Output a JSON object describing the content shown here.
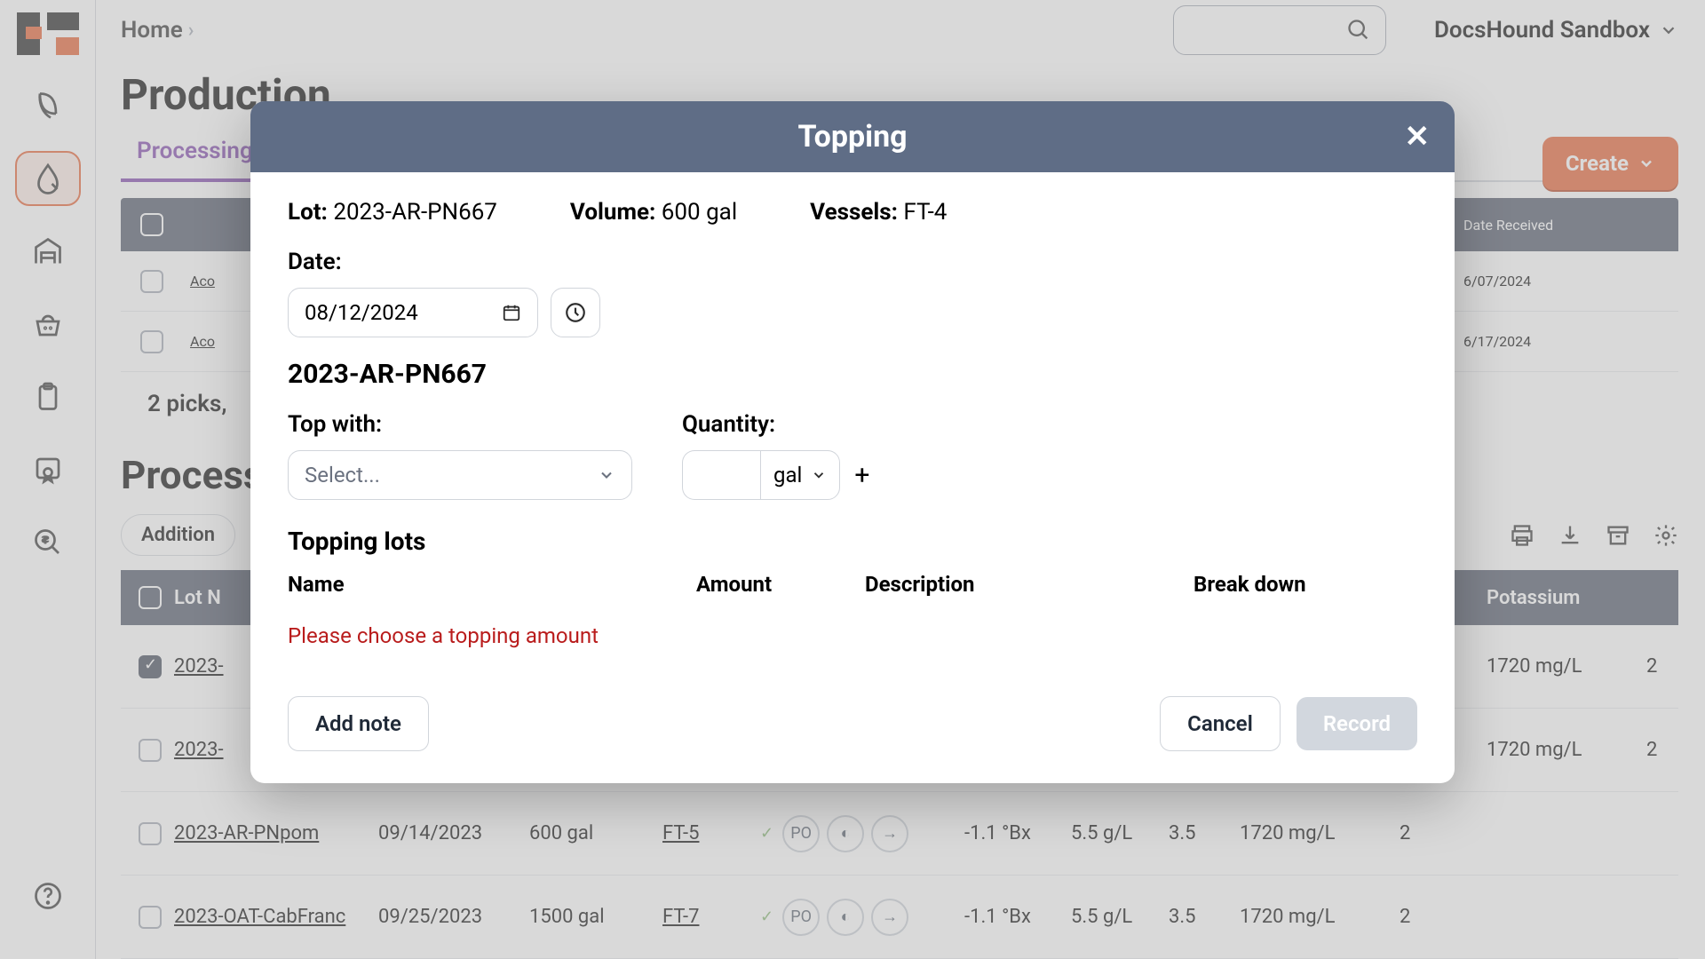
{
  "breadcrumb": {
    "home": "Home"
  },
  "org": {
    "name": "DocsHound Sandbox"
  },
  "page": {
    "title": "Production"
  },
  "tabs": {
    "processing": "Processing"
  },
  "create_btn": "Create",
  "top_table": {
    "header_checkbox": "",
    "date_received_header": "Date Received",
    "row1": {
      "src": "Aco",
      "date": "6/07/2024"
    },
    "row2": {
      "src": "Aco",
      "date": "6/17/2024"
    },
    "summary": "2 picks,"
  },
  "processing_section": {
    "title": "Process",
    "chip_addition": "Addition",
    "headers": {
      "lot": "Lot N",
      "potassium": "Potassium"
    },
    "rows": [
      {
        "lot": "2023-",
        "potassium": "1720 mg/L",
        "extra": "2"
      },
      {
        "lot": "2023-",
        "potassium": "1720 mg/L",
        "extra": "2"
      },
      {
        "lot": "2023-AR-PNpom",
        "date": "09/14/2023",
        "vol": "600 gal",
        "vessel": "FT-5",
        "po": "PO",
        "brix": "-1.1 °Bx",
        "ta": "5.5 g/L",
        "ph": "3.5",
        "potassium": "1720 mg/L",
        "extra": "2"
      },
      {
        "lot": "2023-OAT-CabFranc",
        "date": "09/25/2023",
        "vol": "1500 gal",
        "vessel": "FT-7",
        "po": "PO",
        "brix": "-1.1 °Bx",
        "ta": "5.5 g/L",
        "ph": "3.5",
        "potassium": "1720 mg/L",
        "extra": "2"
      }
    ]
  },
  "modal": {
    "title": "Topping",
    "lot_label": "Lot:",
    "lot_value": "2023-AR-PN667",
    "volume_label": "Volume:",
    "volume_value": "600 gal",
    "vessels_label": "Vessels:",
    "vessels_value": "FT-4",
    "date_label": "Date:",
    "date_value": "08/12/2024",
    "lot_sub": "2023-AR-PN667",
    "top_with_label": "Top with:",
    "top_with_placeholder": "Select...",
    "quantity_label": "Quantity:",
    "qty_unit": "gal",
    "tl_title": "Topping lots",
    "tl_name": "Name",
    "tl_amount": "Amount",
    "tl_desc": "Description",
    "tl_break": "Break down",
    "error": "Please choose a topping amount",
    "add_note": "Add note",
    "cancel": "Cancel",
    "record": "Record"
  }
}
